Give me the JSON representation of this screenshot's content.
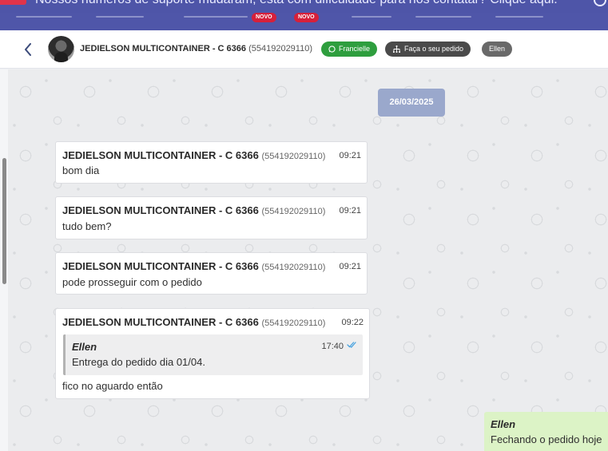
{
  "banner": {
    "text": "Nossos números de suporte mudaram, está com dificuldade para nos contatar? Clique aqui."
  },
  "nav": {
    "badges": [
      "NOVO",
      "NOVO"
    ]
  },
  "header": {
    "contact_name": "JEDIELSON MULTICONTAINER - C 6366",
    "contact_phone": "(554192029110)",
    "tags": {
      "whatsapp": "Francielle",
      "order": "Faça o seu pedido",
      "user": "Ellen"
    }
  },
  "chat": {
    "date": "26/03/2025",
    "messages": [
      {
        "sender": "JEDIELSON MULTICONTAINER - C 6366",
        "phone": "(554192029110)",
        "time": "09:21",
        "text": "bom dia"
      },
      {
        "sender": "JEDIELSON MULTICONTAINER - C 6366",
        "phone": "(554192029110)",
        "time": "09:21",
        "text": "tudo bem?"
      },
      {
        "sender": "JEDIELSON MULTICONTAINER - C 6366",
        "phone": "(554192029110)",
        "time": "09:21",
        "text": "pode prosseguir com o pedido"
      },
      {
        "sender": "JEDIELSON MULTICONTAINER - C 6366",
        "phone": "(554192029110)",
        "time": "09:22",
        "quote": {
          "author": "Ellen",
          "time": "17:40",
          "text": "Entrega do pedido dia 01/04."
        },
        "text": "fico no aguardo então"
      }
    ],
    "sent": {
      "author": "Ellen",
      "text": "Fechando o pedido hoje"
    }
  },
  "colors": {
    "banner": "#4e55a8",
    "whatsapp_green": "#2e9e3e",
    "date_chip": "#9aa8cc",
    "sent_bubble": "#dcf3c6"
  }
}
